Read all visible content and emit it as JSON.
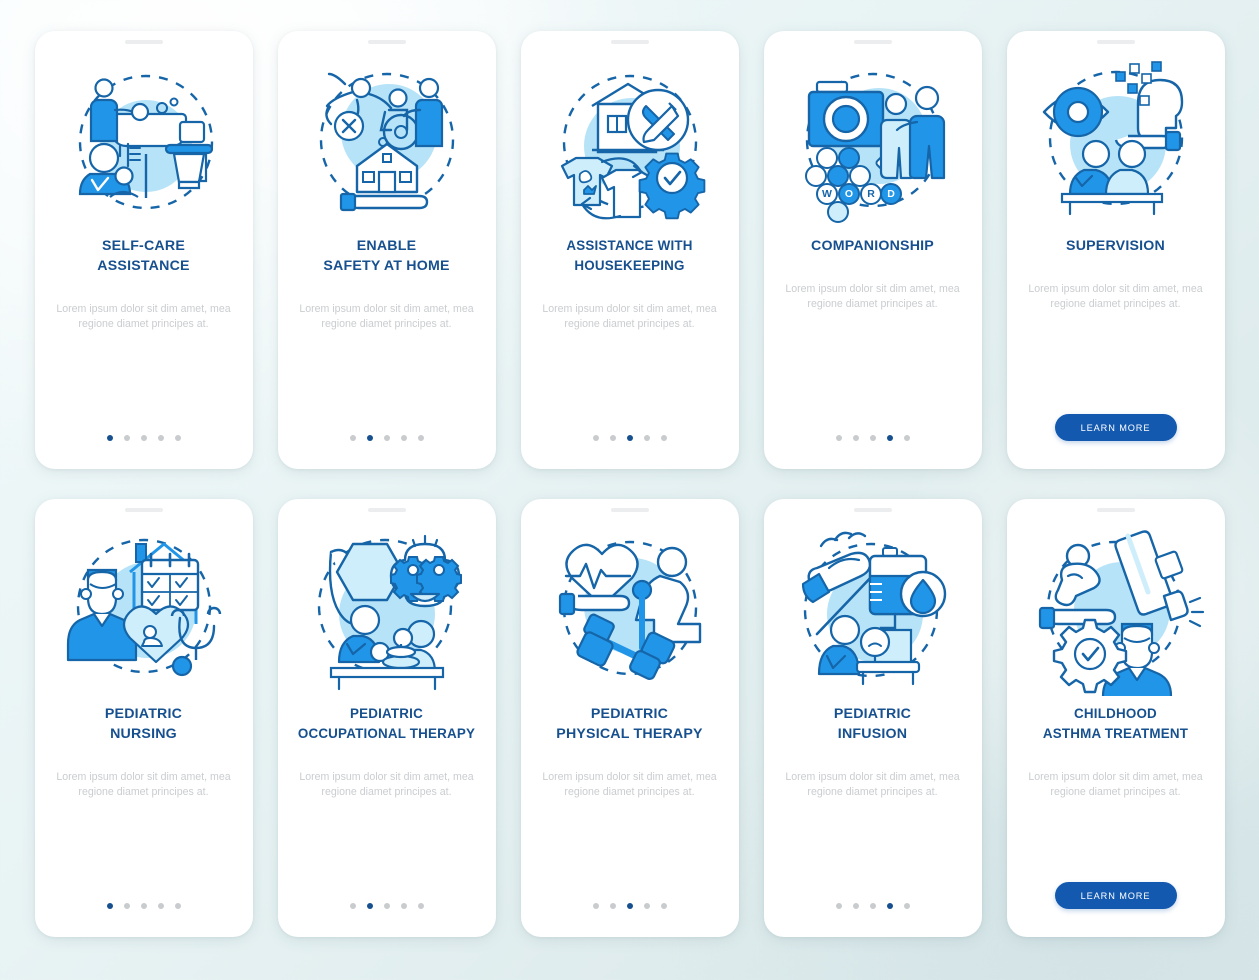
{
  "palette": {
    "page_background": "#e8f3f4",
    "card_background": "#ffffff",
    "title_color": "#17508f",
    "description_color": "#cacdd0",
    "dot_active": "#17508f",
    "dot_inactive": "#c9ccce",
    "button_background": "#1359b0",
    "button_text": "#ffffff",
    "illustration_dark_stroke": "#1565a8",
    "illustration_bright_blue": "#2196e8",
    "illustration_pale_blue": "#aee0f5",
    "illustration_circle_backdrop": "#b6e3f7"
  },
  "common": {
    "description": "Lorem ipsum dolor sit dim amet, mea regione diamet principes at.",
    "learn_more_label": "LEARN MORE",
    "dot_count": 5
  },
  "cards": [
    {
      "id": "self-care-assistance",
      "title": "SELF-CARE\nASSISTANCE",
      "illustration_name": "self-care-bathing-toilet-illustration",
      "description": "Lorem ipsum dolor sit dim amet, mea regione diamet principes at.",
      "footer_type": "dots",
      "active_dot": 1
    },
    {
      "id": "enable-safety-at-home",
      "title": "ENABLE\nSAFETY AT HOME",
      "illustration_name": "home-safety-fall-prevention-illustration",
      "description": "Lorem ipsum dolor sit dim amet, mea regione diamet principes at.",
      "footer_type": "dots",
      "active_dot": 2
    },
    {
      "id": "assistance-with-housekeeping",
      "title": "ASSISTANCE WITH\nHOUSEKEEPING",
      "illustration_name": "housekeeping-laundry-repair-illustration",
      "description": "Lorem ipsum dolor sit dim amet, mea regione diamet principes at.",
      "footer_type": "dots",
      "active_dot": 3
    },
    {
      "id": "companionship",
      "title": "COMPANIONSHIP",
      "illustration_name": "companionship-wordgame-camera-illustration",
      "description": "Lorem ipsum dolor sit dim amet, mea regione diamet principes at.",
      "footer_type": "dots",
      "active_dot": 4
    },
    {
      "id": "supervision",
      "title": "SUPERVISION",
      "illustration_name": "supervision-eye-monitoring-illustration",
      "description": "Lorem ipsum dolor sit dim amet, mea regione diamet principes at.",
      "footer_type": "button",
      "button_label": "LEARN MORE"
    },
    {
      "id": "pediatric-nursing",
      "title": "PEDIATRIC\nNURSING",
      "illustration_name": "pediatric-nursing-stethoscope-illustration",
      "description": "Lorem ipsum dolor sit dim amet, mea regione diamet principes at.",
      "footer_type": "dots",
      "active_dot": 1
    },
    {
      "id": "pediatric-occupational-therapy",
      "title": "PEDIATRIC\nOCCUPATIONAL THERAPY",
      "illustration_name": "occupational-therapy-shapes-illustration",
      "description": "Lorem ipsum dolor sit dim amet, mea regione diamet principes at.",
      "footer_type": "dots",
      "active_dot": 2
    },
    {
      "id": "pediatric-physical-therapy",
      "title": "PEDIATRIC\nPHYSICAL THERAPY",
      "illustration_name": "physical-therapy-dumbbell-heart-illustration",
      "description": "Lorem ipsum dolor sit dim amet, mea regione diamet principes at.",
      "footer_type": "dots",
      "active_dot": 3
    },
    {
      "id": "pediatric-infusion",
      "title": "PEDIATRIC\nINFUSION",
      "illustration_name": "pediatric-infusion-iv-drip-illustration",
      "description": "Lorem ipsum dolor sit dim amet, mea regione diamet principes at.",
      "footer_type": "dots",
      "active_dot": 4
    },
    {
      "id": "childhood-asthma-treatment",
      "title": "CHILDHOOD\nASTHMA TREATMENT",
      "illustration_name": "asthma-inhaler-doctor-illustration",
      "description": "Lorem ipsum dolor sit dim amet, mea regione diamet principes at.",
      "footer_type": "button",
      "button_label": "LEARN MORE"
    }
  ]
}
